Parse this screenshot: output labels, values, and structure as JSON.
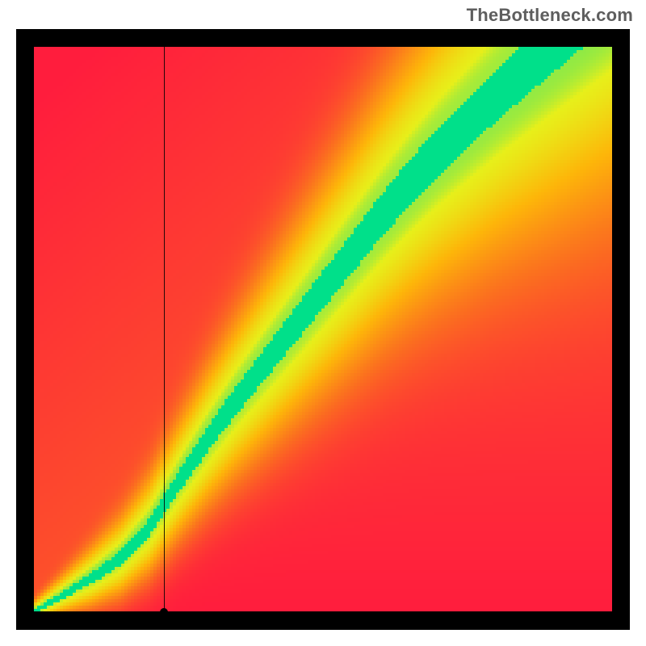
{
  "watermark_text": "TheBottleneck.com",
  "chart_data": {
    "type": "heatmap",
    "title": "",
    "xlabel": "",
    "ylabel": "",
    "xlim": [
      0,
      1
    ],
    "ylim": [
      0,
      1
    ],
    "optimal_curve_points": [
      {
        "x": 0.0,
        "y": 0.0
      },
      {
        "x": 0.05,
        "y": 0.03
      },
      {
        "x": 0.1,
        "y": 0.06
      },
      {
        "x": 0.15,
        "y": 0.095
      },
      {
        "x": 0.2,
        "y": 0.15
      },
      {
        "x": 0.25,
        "y": 0.23
      },
      {
        "x": 0.3,
        "y": 0.305
      },
      {
        "x": 0.35,
        "y": 0.375
      },
      {
        "x": 0.4,
        "y": 0.44
      },
      {
        "x": 0.45,
        "y": 0.505
      },
      {
        "x": 0.5,
        "y": 0.57
      },
      {
        "x": 0.55,
        "y": 0.635
      },
      {
        "x": 0.6,
        "y": 0.7
      },
      {
        "x": 0.65,
        "y": 0.76
      },
      {
        "x": 0.7,
        "y": 0.815
      },
      {
        "x": 0.75,
        "y": 0.865
      },
      {
        "x": 0.8,
        "y": 0.915
      },
      {
        "x": 0.85,
        "y": 0.96
      },
      {
        "x": 0.9,
        "y": 1.005
      },
      {
        "x": 0.95,
        "y": 1.05
      },
      {
        "x": 1.0,
        "y": 1.095
      }
    ],
    "band_halfwidth_points": [
      {
        "x": 0.0,
        "w": 0.004
      },
      {
        "x": 0.05,
        "w": 0.006
      },
      {
        "x": 0.1,
        "w": 0.01
      },
      {
        "x": 0.2,
        "w": 0.015
      },
      {
        "x": 0.3,
        "w": 0.022
      },
      {
        "x": 0.4,
        "w": 0.028
      },
      {
        "x": 0.5,
        "w": 0.033
      },
      {
        "x": 0.6,
        "w": 0.038
      },
      {
        "x": 0.7,
        "w": 0.042
      },
      {
        "x": 0.8,
        "w": 0.046
      },
      {
        "x": 0.9,
        "w": 0.049
      },
      {
        "x": 1.0,
        "w": 0.052
      }
    ],
    "color_stops": [
      {
        "t": 0.0,
        "color": "#00e08a"
      },
      {
        "t": 0.12,
        "color": "#e7ef1a"
      },
      {
        "t": 0.35,
        "color": "#fdb609"
      },
      {
        "t": 0.65,
        "color": "#fb6f1f"
      },
      {
        "t": 1.0,
        "color": "#ff1d3d"
      }
    ],
    "marker": {
      "x": 0.225,
      "y": 0.0
    },
    "crosshair": {
      "x": 0.225,
      "y": 0.0
    },
    "pixelated": true,
    "pixel_block": 4
  }
}
